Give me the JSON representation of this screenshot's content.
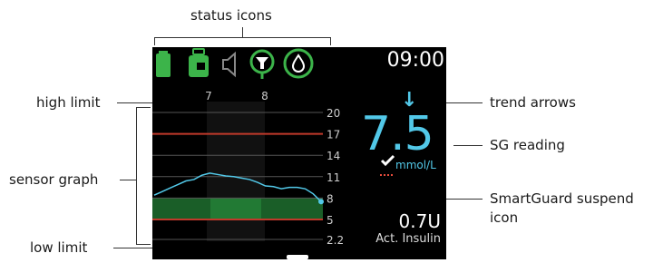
{
  "callouts": {
    "status_icons": "status icons",
    "high_limit": "high limit",
    "sensor_graph": "sensor graph",
    "low_limit": "low limit",
    "trend_arrows": "trend arrows",
    "sg_reading": "SG reading",
    "smartguard_line1": "SmartGuard suspend",
    "smartguard_line2": "icon"
  },
  "screen": {
    "time": "09:00",
    "status_icons": [
      "battery-icon",
      "reservoir-icon",
      "speaker-icon",
      "sensor-signal-icon",
      "drop-icon"
    ],
    "trend_arrow": "↓",
    "sg_value": "7.5",
    "sg_unit": "mmol/L",
    "active_insulin_value": "0.7U",
    "active_insulin_label": "Act. Insulin"
  },
  "chart_data": {
    "type": "line",
    "x_ticks": [
      "7",
      "8"
    ],
    "y_ticks": [
      20,
      17,
      14,
      11,
      8,
      5,
      2.2
    ],
    "ylim": [
      2.2,
      20
    ],
    "high_limit": 17,
    "low_limit": 5,
    "target_range": [
      5,
      8
    ],
    "series": [
      {
        "values": [
          8.4,
          8.9,
          9.4,
          9.9,
          10.4,
          10.6,
          11.2,
          11.5,
          11.3,
          11.1,
          11.0,
          10.8,
          10.6,
          10.2,
          9.7,
          9.6,
          9.3,
          9.5,
          9.5,
          9.3,
          8.6,
          7.5
        ]
      }
    ]
  },
  "colors": {
    "screen_bg": "#000000",
    "accent": "#52c8e8",
    "green": "#3cb44a",
    "limit_line": "#c0392b",
    "target_band": "#1a5e28"
  }
}
